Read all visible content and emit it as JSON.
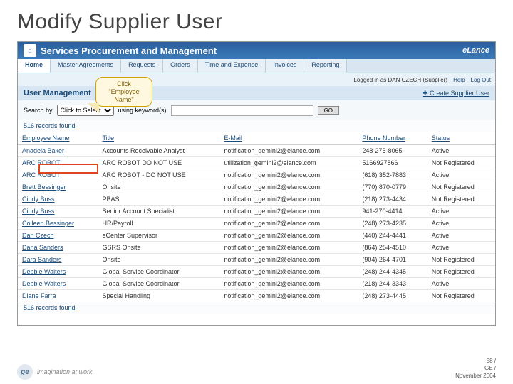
{
  "slide_title": "Modify Supplier User",
  "header": {
    "app_title": "Services Procurement and Management",
    "brand": "eLance"
  },
  "nav": {
    "tabs": [
      {
        "label": "Home",
        "active": true
      },
      {
        "label": "Master Agreements",
        "active": false
      },
      {
        "label": "Requests",
        "active": false
      },
      {
        "label": "Orders",
        "active": false
      },
      {
        "label": "Time and Expense",
        "active": false
      },
      {
        "label": "Invoices",
        "active": false
      },
      {
        "label": "Reporting",
        "active": false
      }
    ]
  },
  "login_bar": {
    "status": "Logged in as DAN CZECH (Supplier)",
    "help": "Help",
    "logout": "Log Out"
  },
  "page": {
    "title": "User Management",
    "create_link": "Create Supplier User"
  },
  "search": {
    "label": "Search by",
    "select_placeholder": "Click to Select",
    "keywords_label": "using keyword(s)",
    "keywords_value": "",
    "go": "GO"
  },
  "records_text": "516 records found",
  "columns": [
    "Employee Name",
    "Title",
    "E-Mail",
    "Phone Number",
    "Status"
  ],
  "rows": [
    {
      "name": "Anadela Baker",
      "title": "Accounts Receivable Analyst",
      "email": "notification_gemini2@elance.com",
      "phone": "248-275-8065",
      "status": "Active"
    },
    {
      "name": "ARC ROBOT",
      "title": "ARC ROBOT DO NOT USE",
      "email": "utilization_gemini2@elance.com",
      "phone": "5166927866",
      "status": "Not Registered"
    },
    {
      "name": "ARC ROBOT",
      "title": "ARC ROBOT - DO NOT USE",
      "email": "notification_gemini2@elance.com",
      "phone": "(618) 352-7883",
      "status": "Active"
    },
    {
      "name": "Brett Bessinger",
      "title": "Onsite",
      "email": "notification_gemini2@elance.com",
      "phone": "(770) 870-0779",
      "status": "Not Registered"
    },
    {
      "name": "Cindy Buss",
      "title": "PBAS",
      "email": "notification_gemini2@elance.com",
      "phone": "(218) 273-4434",
      "status": "Not Registered"
    },
    {
      "name": "Cindy Buss",
      "title": "Senior Account Specialist",
      "email": "notification_gemini2@elance.com",
      "phone": "941-270-4414",
      "status": "Active"
    },
    {
      "name": "Colleen Bessinger",
      "title": "HR/Payroll",
      "email": "notification_gemini2@elance.com",
      "phone": "(248) 273-4235",
      "status": "Active"
    },
    {
      "name": "Dan Czech",
      "title": "eCenter Supervisor",
      "email": "notification_gemini2@elance.com",
      "phone": "(440) 244-4441",
      "status": "Active"
    },
    {
      "name": "Dana Sanders",
      "title": "GSRS Onsite",
      "email": "notification_gemini2@elance.com",
      "phone": "(864) 254-4510",
      "status": "Active"
    },
    {
      "name": "Dara Sanders",
      "title": "Onsite",
      "email": "notification_gemini2@elance.com",
      "phone": "(904) 264-4701",
      "status": "Not Registered"
    },
    {
      "name": "Debbie Walters",
      "title": "Global Service Coordinator",
      "email": "notification_gemini2@elance.com",
      "phone": "(248) 244-4345",
      "status": "Not Registered"
    },
    {
      "name": "Debbie Walters",
      "title": "Global Service Coordinator",
      "email": "notification_gemini2@elance.com",
      "phone": "(218) 244-3343",
      "status": "Active"
    },
    {
      "name": "Diane Farra",
      "title": "Special Handling",
      "email": "notification_gemini2@elance.com",
      "phone": "(248) 273-4445",
      "status": "Not Registered"
    }
  ],
  "callout": {
    "line1": "Click",
    "line2": "\"Employee",
    "line3": "Name\""
  },
  "footer": {
    "ge_tag": "imagination at work",
    "ge_initials": "ge",
    "page_num": "58 /",
    "org": "GE /",
    "date": "November 2004"
  }
}
